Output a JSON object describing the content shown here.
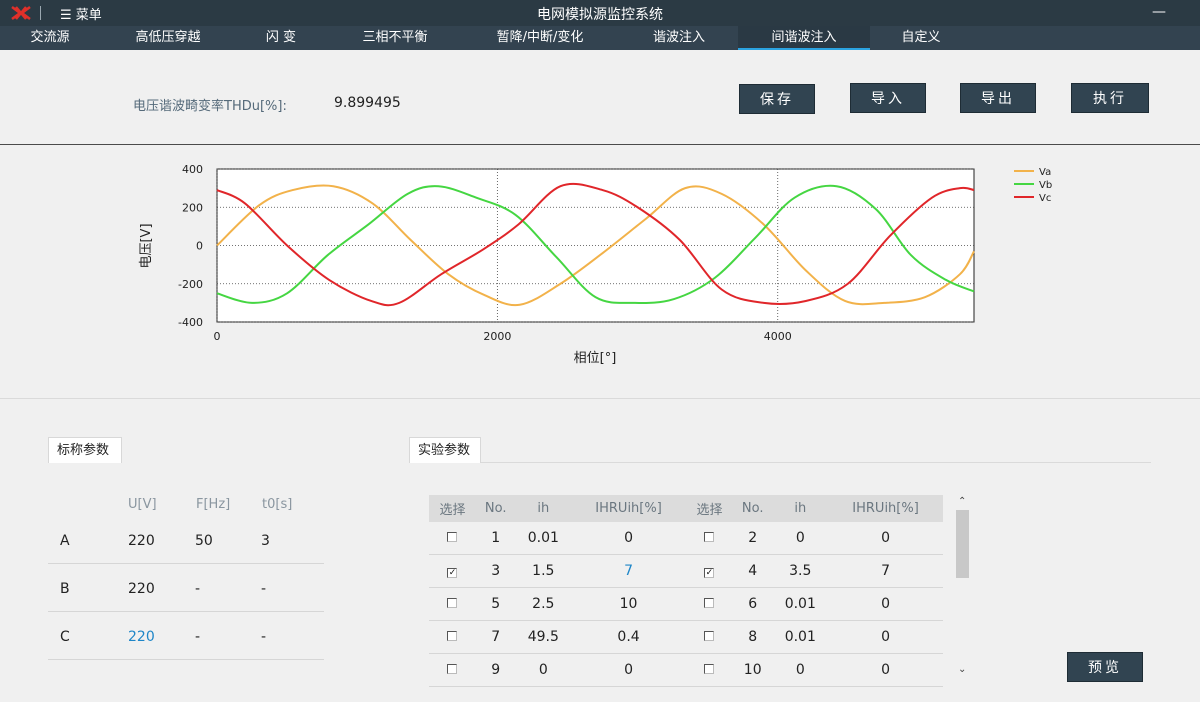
{
  "window": {
    "title": "电网模拟源监控系统",
    "menu_label": "☰ 菜单",
    "minimize": "—"
  },
  "tabs": [
    "交流源",
    "高低压穿越",
    "闪 变",
    "三相不平衡",
    "暂降/中断/变化",
    "谐波注入",
    "间谐波注入",
    "自定义"
  ],
  "active_tab": "间谐波注入",
  "thd": {
    "label": "电压谐波畸变率THDu[%]:",
    "value": "9.899495"
  },
  "buttons": {
    "save": "保存",
    "import": "导入",
    "export": "导出",
    "execute": "执行",
    "preview": "预览"
  },
  "chart_data": {
    "type": "line",
    "xlabel": "相位[°]",
    "ylabel": "电压[V]",
    "xlim": [
      0,
      5400
    ],
    "ylim": [
      -400,
      400
    ],
    "x_ticks": [
      "0",
      "2000",
      "4000"
    ],
    "y_ticks": [
      "400",
      "200",
      "0",
      "-200",
      "-400"
    ],
    "grid": true,
    "legend_position": "top-right",
    "series": [
      {
        "name": "Va",
        "color": "#f2b24a",
        "x": [
          0,
          300,
          540,
          830,
          1110,
          1380,
          1650,
          1910,
          2160,
          2450,
          2750,
          3060,
          3340,
          3600,
          3900,
          4200,
          4480,
          4760,
          5050,
          5300,
          5400
        ],
        "values": [
          0,
          210,
          290,
          310,
          220,
          30,
          -150,
          -260,
          -310,
          -200,
          -40,
          140,
          300,
          270,
          110,
          -130,
          -290,
          -300,
          -270,
          -150,
          -30
        ]
      },
      {
        "name": "Vb",
        "color": "#45d642",
        "x": [
          0,
          250,
          500,
          790,
          1080,
          1360,
          1580,
          1850,
          2130,
          2420,
          2700,
          2980,
          3260,
          3550,
          3840,
          4120,
          4420,
          4700,
          4950,
          5200,
          5400
        ],
        "values": [
          -250,
          -300,
          -250,
          -50,
          110,
          270,
          310,
          250,
          160,
          -60,
          -270,
          -300,
          -280,
          -170,
          40,
          250,
          310,
          190,
          -50,
          -180,
          -240
        ]
      },
      {
        "name": "Vc",
        "color": "#e0262a",
        "x": [
          0,
          200,
          500,
          800,
          1100,
          1300,
          1600,
          1900,
          2150,
          2450,
          2750,
          3000,
          3300,
          3600,
          3900,
          4200,
          4500,
          4800,
          5100,
          5300,
          5400
        ],
        "values": [
          290,
          220,
          0,
          -180,
          -290,
          -300,
          -150,
          -20,
          110,
          310,
          290,
          200,
          30,
          -230,
          -300,
          -290,
          -200,
          50,
          250,
          300,
          290
        ]
      }
    ]
  },
  "nominal": {
    "tab_label": "标称参数",
    "headers": [
      "U[V]",
      "F[Hz]",
      "t0[s]"
    ],
    "rows": [
      {
        "phase": "A",
        "u": "220",
        "f": "50",
        "t0": "3"
      },
      {
        "phase": "B",
        "u": "220",
        "f": "-",
        "t0": "-"
      },
      {
        "phase": "C",
        "u": "220",
        "f": "-",
        "t0": "-"
      }
    ],
    "highlight_color": "#1e86c8"
  },
  "experiment": {
    "tab_label": "实验参数",
    "headers": [
      "选择",
      "No.",
      "ih",
      "IHRUih[%]",
      "选择",
      "No.",
      "ih",
      "IHRUih[%]"
    ],
    "rows": [
      {
        "sel1": false,
        "no1": "1",
        "ih1": "0.01",
        "ihr1": "0",
        "sel2": false,
        "no2": "2",
        "ih2": "0",
        "ihr2": "0"
      },
      {
        "sel1": true,
        "no1": "3",
        "ih1": "1.5",
        "ihr1": "7",
        "sel2": true,
        "no2": "4",
        "ih2": "3.5",
        "ihr2": "7"
      },
      {
        "sel1": false,
        "no1": "5",
        "ih1": "2.5",
        "ihr1": "10",
        "sel2": false,
        "no2": "6",
        "ih2": "0.01",
        "ihr2": "0"
      },
      {
        "sel1": false,
        "no1": "7",
        "ih1": "49.5",
        "ihr1": "0.4",
        "sel2": false,
        "no2": "8",
        "ih2": "0.01",
        "ihr2": "0"
      },
      {
        "sel1": false,
        "no1": "9",
        "ih1": "0",
        "ihr1": "0",
        "sel2": false,
        "no2": "10",
        "ih2": "0",
        "ihr2": "0"
      }
    ],
    "scroll_up": "⌃",
    "scroll_down": "⌄"
  }
}
